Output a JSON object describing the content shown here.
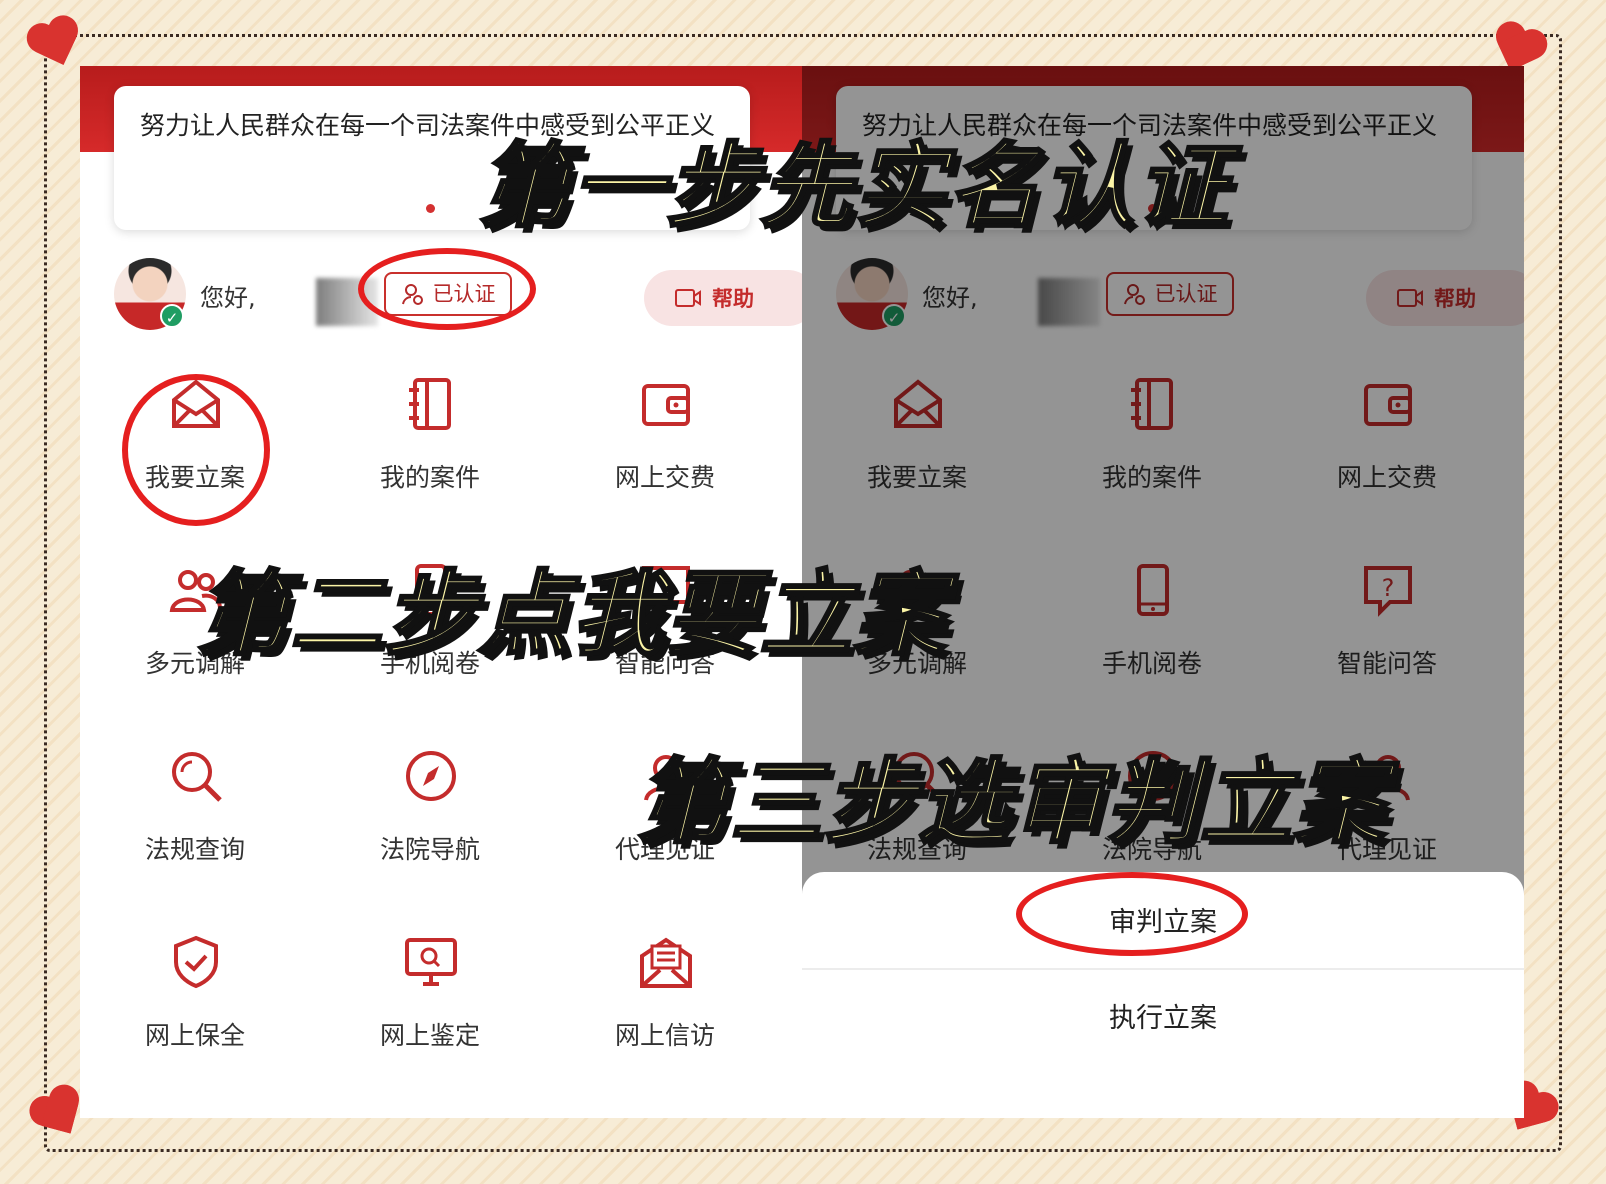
{
  "colors": {
    "brand_red": "#c42c2c",
    "overlay_text": "#fbf4a6",
    "annotation_ring": "#e51f1f",
    "verified_green": "#1f9d63"
  },
  "left_screen": {
    "slogan": "努力让人民群众在每一个司法案件中感受到公平正义",
    "user": {
      "greeting": "您好,",
      "verify_label": "已认证",
      "help_label": "帮助"
    },
    "menu": [
      {
        "label": "我要立案",
        "icon": "envelope-icon"
      },
      {
        "label": "我的案件",
        "icon": "notebook-icon"
      },
      {
        "label": "网上交费",
        "icon": "wallet-icon"
      },
      {
        "label": "多元调解",
        "icon": "people-icon"
      },
      {
        "label": "手机阅卷",
        "icon": "phone-icon"
      },
      {
        "label": "智能问答",
        "icon": "question-icon"
      },
      {
        "label": "法规查询",
        "icon": "search-icon"
      },
      {
        "label": "法院导航",
        "icon": "compass-icon"
      },
      {
        "label": "代理见证",
        "icon": "witness-icon"
      },
      {
        "label": "网上保全",
        "icon": "shield-check-icon"
      },
      {
        "label": "网上鉴定",
        "icon": "monitor-search-icon"
      },
      {
        "label": "网上信访",
        "icon": "letter-icon"
      }
    ]
  },
  "right_screen": {
    "action_sheet": {
      "option1": "审判立案",
      "option2": "执行立案"
    }
  },
  "overlay": {
    "step1": "第一步先实名认证",
    "step2": "第二步点我要立案",
    "step3": "第三步选审判立案"
  }
}
